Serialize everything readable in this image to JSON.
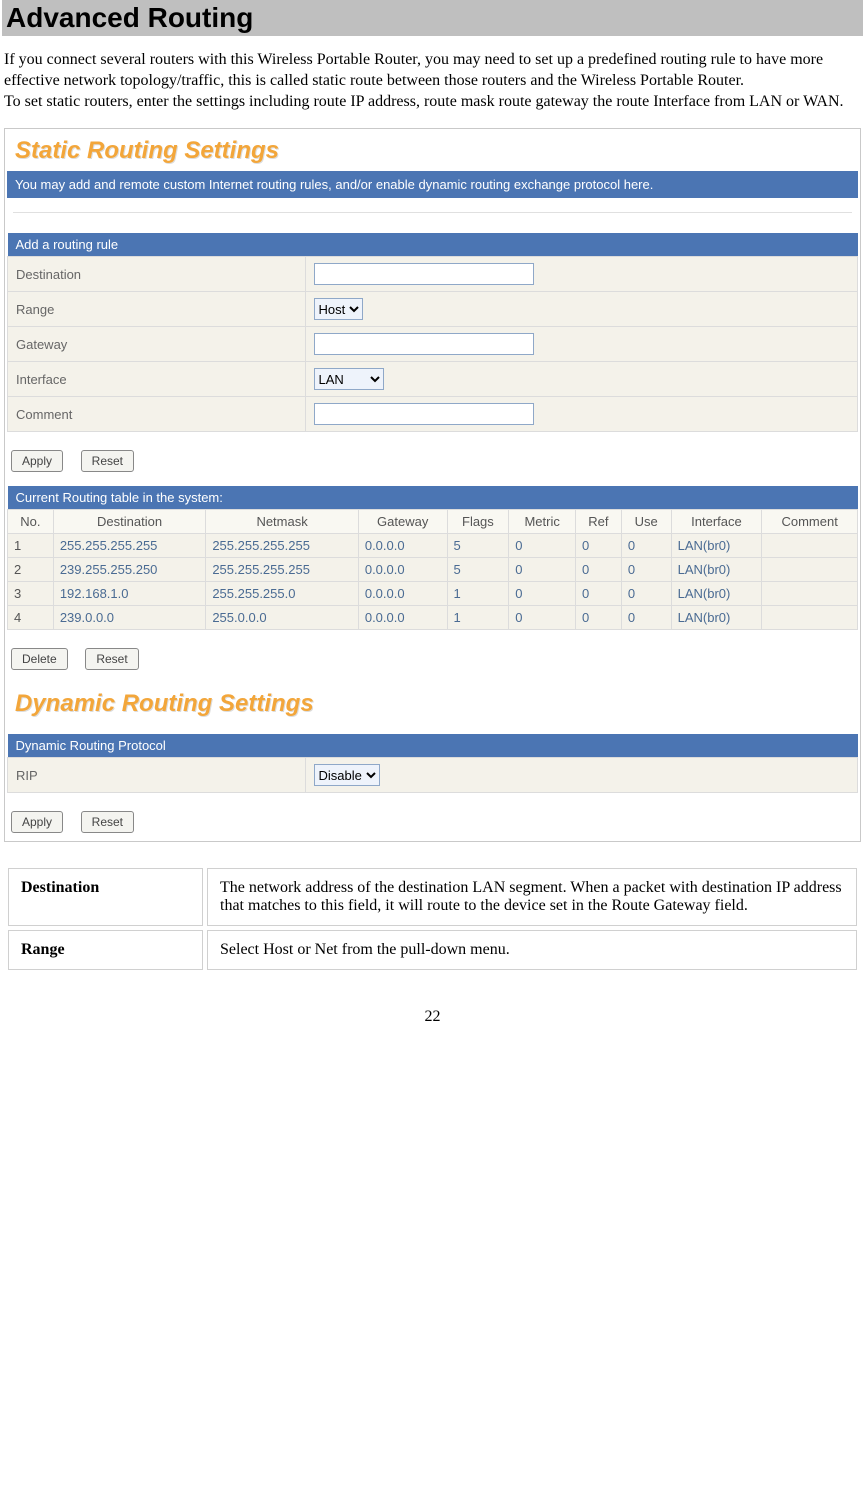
{
  "page_title": "Advanced Routing",
  "intro_p1": "If you connect several routers with this Wireless Portable Router, you may need to set up a predefined routing rule to have more effective network topology/traffic, this is called static route between those routers and the Wireless Portable Router.",
  "intro_p2": "To set static routers, enter the settings including route IP address, route mask route gateway the route Interface from LAN or WAN.",
  "static": {
    "heading": "Static Routing Settings",
    "info_bar": "You may add and remote custom Internet routing rules, and/or enable dynamic routing exchange protocol here.",
    "add_title": "Add a routing rule",
    "fields": {
      "destination_label": "Destination",
      "range_label": "Range",
      "range_value": "Host",
      "gateway_label": "Gateway",
      "interface_label": "Interface",
      "interface_value": "LAN",
      "comment_label": "Comment"
    },
    "buttons": {
      "apply": "Apply",
      "reset": "Reset",
      "delete": "Delete"
    },
    "routing_title": "Current Routing table in the system:",
    "columns": [
      "No.",
      "Destination",
      "Netmask",
      "Gateway",
      "Flags",
      "Metric",
      "Ref",
      "Use",
      "Interface",
      "Comment"
    ],
    "rows": [
      {
        "no": "1",
        "dest": "255.255.255.255",
        "mask": "255.255.255.255",
        "gw": "0.0.0.0",
        "flags": "5",
        "metric": "0",
        "ref": "0",
        "use": "0",
        "iface": "LAN(br0)",
        "comment": ""
      },
      {
        "no": "2",
        "dest": "239.255.255.250",
        "mask": "255.255.255.255",
        "gw": "0.0.0.0",
        "flags": "5",
        "metric": "0",
        "ref": "0",
        "use": "0",
        "iface": "LAN(br0)",
        "comment": ""
      },
      {
        "no": "3",
        "dest": "192.168.1.0",
        "mask": "255.255.255.0",
        "gw": "0.0.0.0",
        "flags": "1",
        "metric": "0",
        "ref": "0",
        "use": "0",
        "iface": "LAN(br0)",
        "comment": ""
      },
      {
        "no": "4",
        "dest": "239.0.0.0",
        "mask": "255.0.0.0",
        "gw": "0.0.0.0",
        "flags": "1",
        "metric": "0",
        "ref": "0",
        "use": "0",
        "iface": "LAN(br0)",
        "comment": ""
      }
    ]
  },
  "dynamic": {
    "heading": "Dynamic Routing Settings",
    "table_title": "Dynamic Routing Protocol",
    "rip_label": "RIP",
    "rip_value": "Disable",
    "buttons": {
      "apply": "Apply",
      "reset": "Reset"
    }
  },
  "definitions": [
    {
      "term": "Destination",
      "def": "The network address of the destination LAN segment. When a packet with destination IP address that matches to this field, it will route to the device set in the Route Gateway field."
    },
    {
      "term": "Range",
      "def": "Select Host or Net from the pull-down menu."
    }
  ],
  "page_number": "22"
}
